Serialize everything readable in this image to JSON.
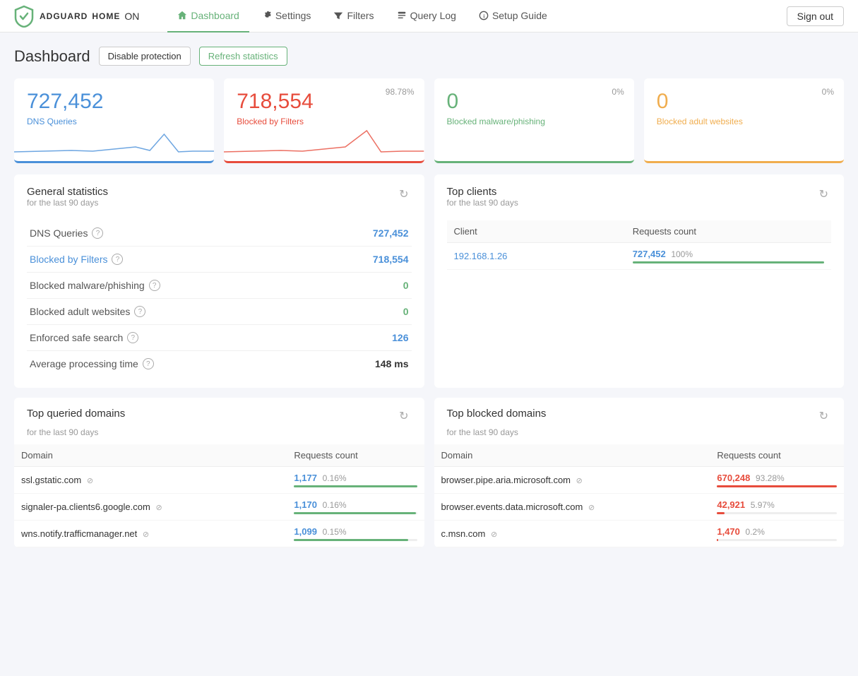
{
  "app": {
    "name": "ADGUARD",
    "name2": "HOME",
    "status": "ON",
    "sign_out": "Sign out"
  },
  "nav": {
    "links": [
      {
        "label": "Dashboard",
        "icon": "home",
        "active": true
      },
      {
        "label": "Settings",
        "icon": "gear"
      },
      {
        "label": "Filters",
        "icon": "filter"
      },
      {
        "label": "Query Log",
        "icon": "log"
      },
      {
        "label": "Setup Guide",
        "icon": "info"
      }
    ]
  },
  "page": {
    "title": "Dashboard",
    "disable_btn": "Disable protection",
    "refresh_btn": "Refresh statistics"
  },
  "stats_cards": [
    {
      "value": "727,452",
      "label": "DNS Queries",
      "color": "blue",
      "percent": "",
      "has_chart": true
    },
    {
      "value": "718,554",
      "label": "Blocked by Filters",
      "color": "red",
      "percent": "98.78%",
      "has_chart": true
    },
    {
      "value": "0",
      "label": "Blocked malware/phishing",
      "color": "green",
      "percent": "0%",
      "has_chart": false
    },
    {
      "value": "0",
      "label": "Blocked adult websites",
      "color": "yellow",
      "percent": "0%",
      "has_chart": false
    }
  ],
  "general_stats": {
    "title": "General statistics",
    "subtitle": "for the last 90 days",
    "rows": [
      {
        "label": "DNS Queries",
        "link": false,
        "value": "727,452",
        "value_color": "blue",
        "help": true
      },
      {
        "label": "Blocked by Filters",
        "link": true,
        "value": "718,554",
        "value_color": "blue",
        "help": true
      },
      {
        "label": "Blocked malware/phishing",
        "link": false,
        "value": "0",
        "value_color": "green",
        "help": true
      },
      {
        "label": "Blocked adult websites",
        "link": false,
        "value": "0",
        "value_color": "green",
        "help": true
      },
      {
        "label": "Enforced safe search",
        "link": false,
        "value": "126",
        "value_color": "blue",
        "help": true
      },
      {
        "label": "Average processing time",
        "link": false,
        "value": "148 ms",
        "value_color": "default",
        "help": true
      }
    ]
  },
  "top_clients": {
    "title": "Top clients",
    "subtitle": "for the last 90 days",
    "col_client": "Client",
    "col_requests": "Requests count",
    "rows": [
      {
        "client": "192.168.1.26",
        "count": "727,452",
        "percent": "100%",
        "bar": 100
      }
    ]
  },
  "top_queried": {
    "title": "Top queried domains",
    "subtitle": "for the last 90 days",
    "col_domain": "Domain",
    "col_requests": "Requests count",
    "rows": [
      {
        "domain": "ssl.gstatic.com",
        "count": "1,177",
        "percent": "0.16%",
        "bar": 100
      },
      {
        "domain": "signaler-pa.clients6.google.com",
        "count": "1,170",
        "percent": "0.16%",
        "bar": 99
      },
      {
        "domain": "wns.notify.trafficmanager.net",
        "count": "1,099",
        "percent": "0.15%",
        "bar": 93
      }
    ]
  },
  "top_blocked": {
    "title": "Top blocked domains",
    "subtitle": "for the last 90 days",
    "col_domain": "Domain",
    "col_requests": "Requests count",
    "rows": [
      {
        "domain": "browser.pipe.aria.microsoft.com",
        "count": "670,248",
        "percent": "93.28%",
        "bar": 100
      },
      {
        "domain": "browser.events.data.microsoft.com",
        "count": "42,921",
        "percent": "5.97%",
        "bar": 6
      },
      {
        "domain": "c.msn.com",
        "count": "1,470",
        "percent": "0.2%",
        "bar": 1
      }
    ]
  }
}
